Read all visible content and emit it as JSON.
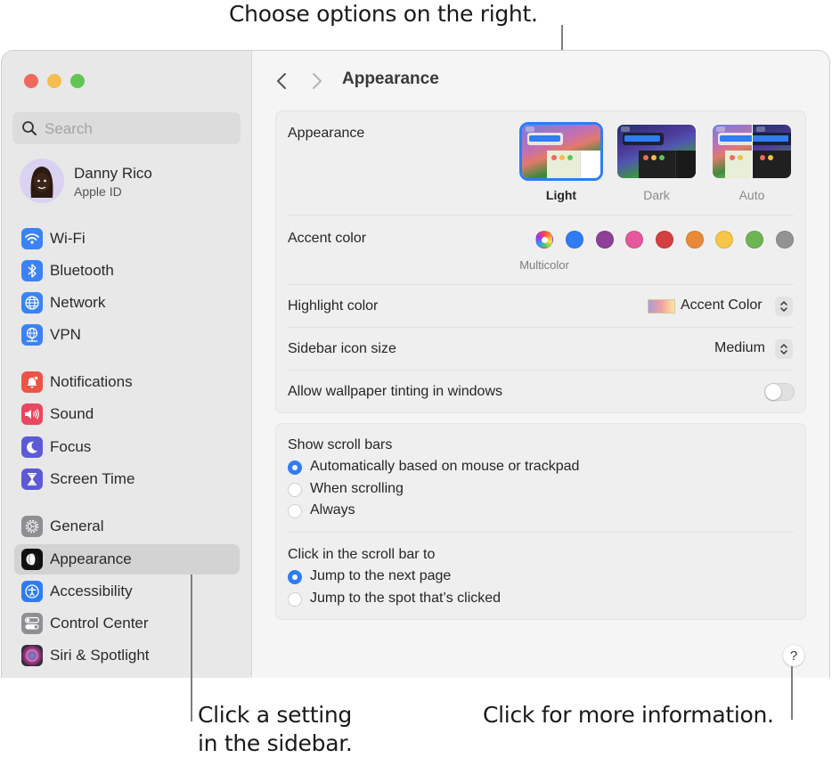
{
  "callouts": {
    "top": "Choose options on the right.",
    "bottom_left_line1": "Click a setting",
    "bottom_left_line2": "in the sidebar.",
    "bottom_right": "Click for more information."
  },
  "window": {
    "traffic_lights": [
      {
        "name": "close",
        "color": "#ee6a5f"
      },
      {
        "name": "minimize",
        "color": "#f5bd4f"
      },
      {
        "name": "zoom",
        "color": "#61c554"
      }
    ]
  },
  "sidebar": {
    "search": {
      "placeholder": "Search",
      "value": ""
    },
    "user": {
      "name": "Danny Rico",
      "subtitle": "Apple ID"
    },
    "items": [
      {
        "label": "Wi-Fi",
        "icon": "wifi-icon",
        "color": "#3b82f6"
      },
      {
        "label": "Bluetooth",
        "icon": "bluetooth-icon",
        "color": "#3b82f6"
      },
      {
        "label": "Network",
        "icon": "globe-icon",
        "color": "#3b82f6"
      },
      {
        "label": "VPN",
        "icon": "vpn-icon",
        "color": "#3b82f6"
      },
      {
        "label": "Notifications",
        "icon": "bell-icon",
        "color": "#ec5545"
      },
      {
        "label": "Sound",
        "icon": "speaker-icon",
        "color": "#e9475f"
      },
      {
        "label": "Focus",
        "icon": "moon-icon",
        "color": "#5c5ad6"
      },
      {
        "label": "Screen Time",
        "icon": "hourglass-icon",
        "color": "#5c5ad6"
      },
      {
        "label": "General",
        "icon": "gear-icon",
        "color": "#8e8e93"
      },
      {
        "label": "Appearance",
        "icon": "appearance-icon",
        "color": "#111111",
        "selected": true
      },
      {
        "label": "Accessibility",
        "icon": "accessibility-icon",
        "color": "#2f7cf6"
      },
      {
        "label": "Control Center",
        "icon": "toggles-icon",
        "color": "#8e8e93"
      },
      {
        "label": "Siri & Spotlight",
        "icon": "siri-icon",
        "color": "#2b2b3a"
      }
    ]
  },
  "main": {
    "title": "Appearance",
    "appearance": {
      "label": "Appearance",
      "options": [
        {
          "label": "Light",
          "selected": true
        },
        {
          "label": "Dark",
          "selected": false
        },
        {
          "label": "Auto",
          "selected": false
        }
      ]
    },
    "accent": {
      "label": "Accent color",
      "selected_label": "Multicolor",
      "colors": [
        {
          "name": "multicolor",
          "hex": "multicolor",
          "selected": true
        },
        {
          "name": "blue",
          "hex": "#2f7cf6"
        },
        {
          "name": "purple",
          "hex": "#8e3f98"
        },
        {
          "name": "pink",
          "hex": "#e5589b"
        },
        {
          "name": "red",
          "hex": "#d4403f"
        },
        {
          "name": "orange",
          "hex": "#ea8a38"
        },
        {
          "name": "yellow",
          "hex": "#f6c649"
        },
        {
          "name": "green",
          "hex": "#6db552"
        },
        {
          "name": "graphite",
          "hex": "#939393"
        }
      ]
    },
    "highlight": {
      "label": "Highlight color",
      "value": "Accent Color"
    },
    "sidebar_icon_size": {
      "label": "Sidebar icon size",
      "value": "Medium"
    },
    "wallpaper_tinting": {
      "label": "Allow wallpaper tinting in windows",
      "on": false
    },
    "scroll_bars": {
      "label": "Show scroll bars",
      "options": [
        {
          "label": "Automatically based on mouse or trackpad",
          "selected": true
        },
        {
          "label": "When scrolling",
          "selected": false
        },
        {
          "label": "Always",
          "selected": false
        }
      ]
    },
    "click_scroll": {
      "label": "Click in the scroll bar to",
      "options": [
        {
          "label": "Jump to the next page",
          "selected": true
        },
        {
          "label": "Jump to the spot that’s clicked",
          "selected": false
        }
      ]
    },
    "help": "?"
  }
}
